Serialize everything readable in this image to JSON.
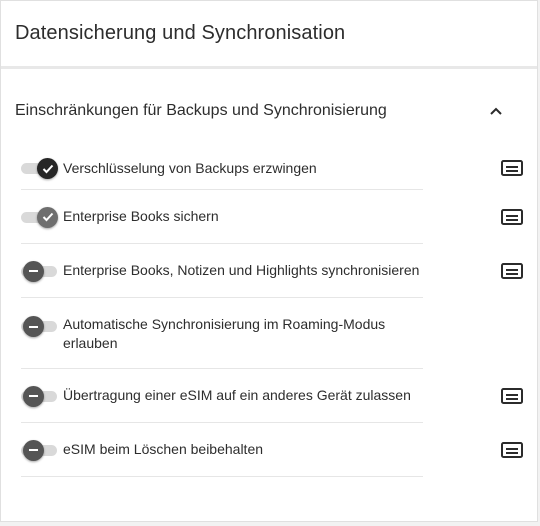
{
  "page": {
    "title": "Datensicherung und Synchronisation"
  },
  "section": {
    "title": "Einschränkungen für Backups und Synchronisierung",
    "chevron_icon": "chevron-up-icon"
  },
  "settings": [
    {
      "label": "Verschlüsselung von Backups erzwingen",
      "state": "on",
      "has_info": true
    },
    {
      "label": "Enterprise Books sichern",
      "state": "on",
      "has_info": true
    },
    {
      "label": "Enterprise Books, Notizen und Highlights synchronisieren",
      "state": "off",
      "has_info": true
    },
    {
      "label": "Automatische Synchronisierung im Roaming-Modus erlauben",
      "state": "off",
      "has_info": false
    },
    {
      "label": "Übertragung einer eSIM auf ein anderes Gerät zulassen",
      "state": "off",
      "has_info": true
    },
    {
      "label": "eSIM beim Löschen beibehalten",
      "state": "off",
      "has_info": true
    }
  ],
  "colors": {
    "toggle_on_dark": "#262626",
    "toggle_on_grey": "#6e6e6e",
    "toggle_off": "#555555",
    "track": "#d9d9d9",
    "divider": "#e6e6e6"
  },
  "icons": {
    "info": "details-card-icon",
    "check": "check-icon",
    "minus": "minus-icon"
  }
}
